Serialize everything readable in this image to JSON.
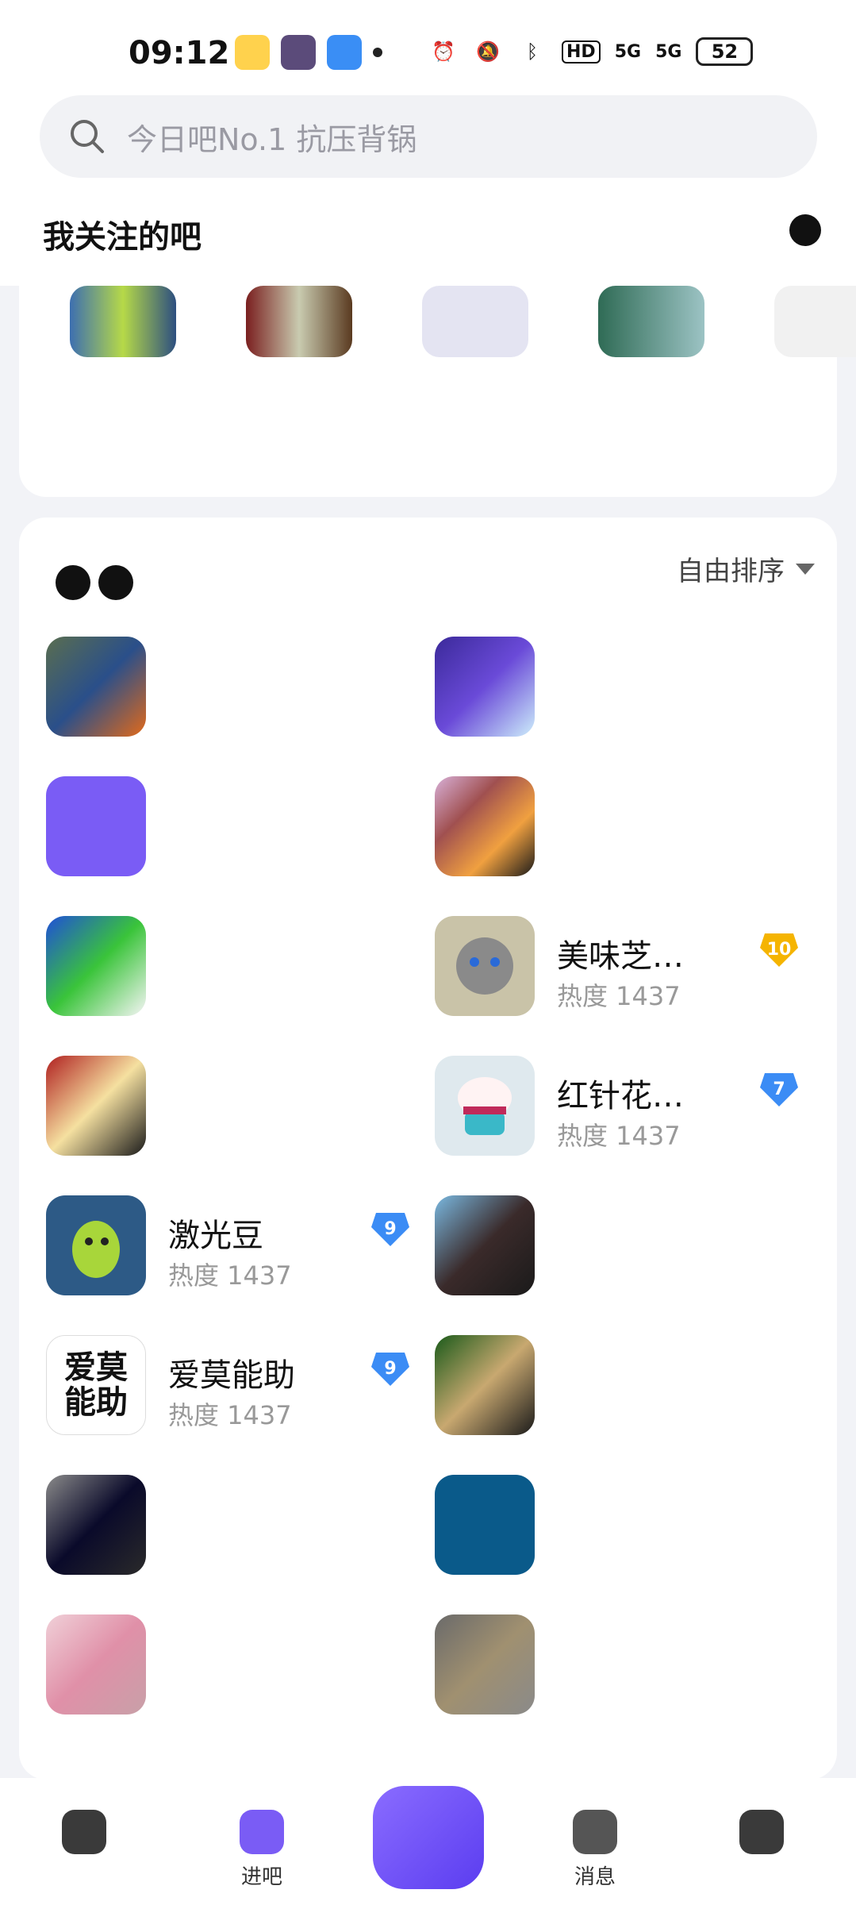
{
  "statusbar": {
    "time": "09:12",
    "network": "5G",
    "hd": "HD",
    "battery": "52"
  },
  "search": {
    "placeholder": "今日吧No.1 抗压背锅"
  },
  "header": {
    "section_title": "我关注的吧"
  },
  "main": {
    "sort_label": "自由排序",
    "items": [
      {
        "name": "美味芝…",
        "heat": "热度 1437",
        "level": "10",
        "badge_color": "#f5b400",
        "avatar_color": "#c9c3a8"
      },
      {
        "name": "红针花…",
        "heat": "热度 1437",
        "level": "7",
        "badge_color": "#3b8cf5",
        "avatar_color": "#dfe9ee"
      },
      {
        "name": "激光豆",
        "heat": "热度 1437",
        "level": "9",
        "badge_color": "#3b8cf5",
        "avatar_color": "#2d5a86"
      },
      {
        "name": "爱莫能助",
        "heat": "热度 1437",
        "level": "9",
        "badge_color": "#3b8cf5",
        "avatar_color": "#ffffff"
      }
    ]
  },
  "nav": {
    "item2_label": "进吧",
    "item4_label": "消息"
  },
  "colors": {
    "accent": "#6b4ef5",
    "badge_blue": "#3b8cf5",
    "badge_gold": "#f5b400"
  }
}
